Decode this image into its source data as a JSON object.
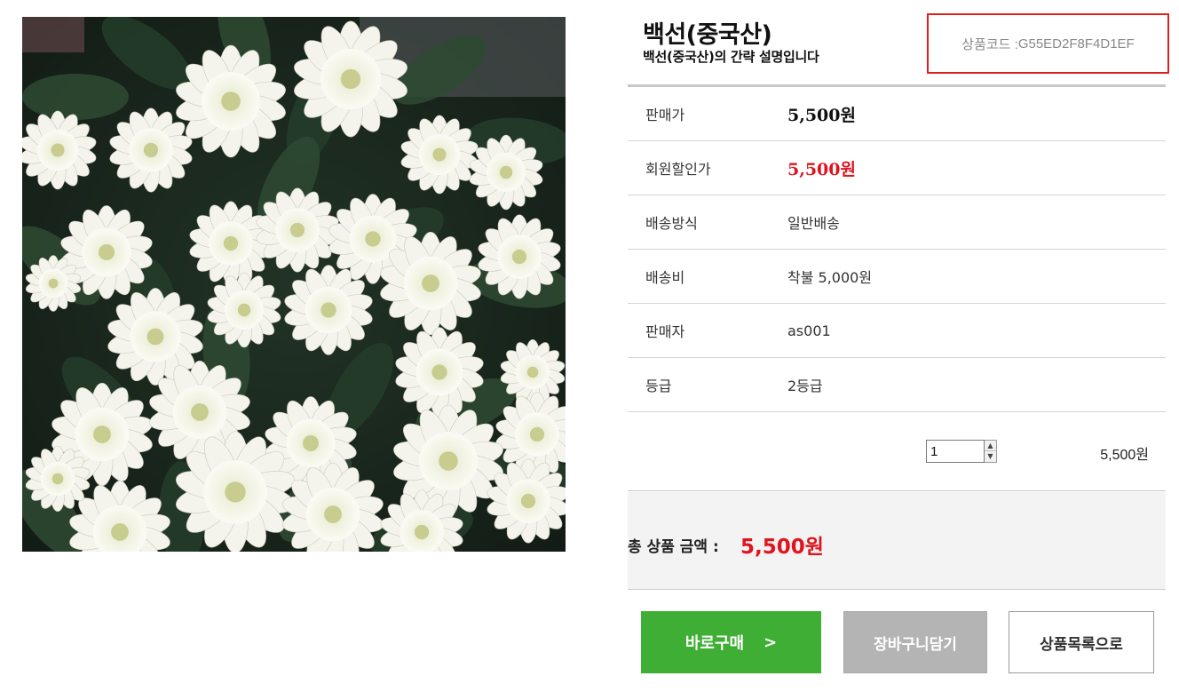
{
  "product": {
    "title": "백선(중국산)",
    "description": "백선(중국산)의 간략 설명입니다",
    "code_label": "상품코드 : ",
    "code_value": "G55ED2F8F4D1EF",
    "image_alt": "white chrysanthemum bouquet"
  },
  "info_rows": [
    {
      "label": "판매가",
      "value": "5,500원"
    },
    {
      "label": "회원할인가",
      "value": "5,500원"
    },
    {
      "label": "배송방식",
      "value": "일반배송"
    },
    {
      "label": "배송비",
      "value": "착불 5,000원"
    },
    {
      "label": "판매자",
      "value": "as001"
    },
    {
      "label": "등급",
      "value": "2등급"
    }
  ],
  "order": {
    "quantity": "1",
    "line_price": "5,500원",
    "total_label": "총 상품 금액 : ",
    "total_value": "5,500원"
  },
  "buttons": {
    "buy": "바로구매",
    "buy_arrow": ">",
    "cart": "장바구니담기",
    "list": "상품목록으로"
  },
  "colors": {
    "accent_green": "#3eae34",
    "price_red": "#e0141e",
    "code_border": "#e02020",
    "cart_gray": "#b4b4b4"
  },
  "icons": {
    "spinner_up": "spinner-up-icon",
    "spinner_down": "spinner-down-icon"
  }
}
